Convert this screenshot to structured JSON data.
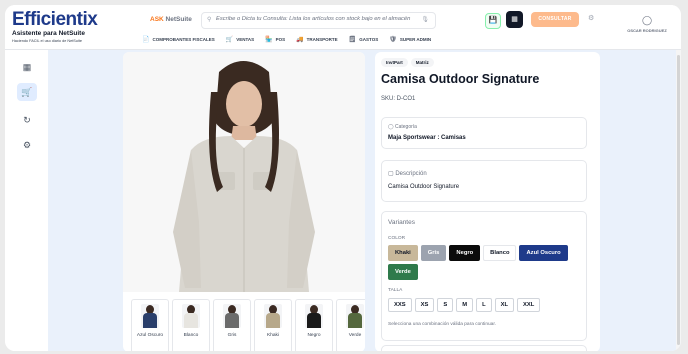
{
  "brand": {
    "logo": "Efficientix",
    "tagline": "Asistente para NetSuite",
    "subtagline": "Haciendo FACIL el uso diario de NetSuite"
  },
  "ask": {
    "label_a": "ASK",
    "label_b": "NetSuite"
  },
  "search": {
    "placeholder": "Escribe o Dicta tu Consulta: Lista los artículos con stock bajo en el almacén"
  },
  "consult_label": "CONSULTAR",
  "user": {
    "name": "OSCAR RODRIGUEZ"
  },
  "nav": [
    {
      "label": "COMPROBANTES FISCALES",
      "icon": "📄"
    },
    {
      "label": "VENTAS",
      "icon": "🛒"
    },
    {
      "label": "POS",
      "icon": "🏪"
    },
    {
      "label": "TRANSPORTE",
      "icon": "🚚"
    },
    {
      "label": "GASTOS",
      "icon": "🗒"
    },
    {
      "label": "SUPER ADMIN",
      "icon": "🛡"
    }
  ],
  "product": {
    "badges": [
      "InvtPart",
      "Matriz"
    ],
    "title": "Camisa Outdoor Signature",
    "sku": "SKU: D-CO1",
    "category_label": "Categoría",
    "category_value": "Maja Sportswear : Camisas",
    "description_label": "Descripción",
    "description_value": "Camisa Outdoor Signature",
    "variants_title": "Variantes",
    "color_label": "COLOR",
    "colors": [
      {
        "name": "Khaki",
        "bg": "#c8b89a",
        "fg": "#111827"
      },
      {
        "name": "Gris",
        "bg": "#9ca3af",
        "fg": "#ffffff"
      },
      {
        "name": "Negro",
        "bg": "#0b0b0b",
        "fg": "#ffffff"
      },
      {
        "name": "Blanco",
        "bg": "#ffffff",
        "fg": "#111827"
      },
      {
        "name": "Azul Oscuro",
        "bg": "#1e3a8a",
        "fg": "#ffffff"
      },
      {
        "name": "Verde",
        "bg": "#2f7a4b",
        "fg": "#ffffff"
      }
    ],
    "size_label": "TALLA",
    "sizes": [
      "XXS",
      "XS",
      "S",
      "M",
      "L",
      "XL",
      "XXL"
    ],
    "hint": "Selecciona una combinación válida para continuar."
  },
  "thumbnails": [
    {
      "label": "Azul Oscuro",
      "color": "#2a3f6b"
    },
    {
      "label": "Blanco",
      "color": "#e7e5e0"
    },
    {
      "label": "Gris",
      "color": "#6b6b6b"
    },
    {
      "label": "Khaki",
      "color": "#b7a88a"
    },
    {
      "label": "Negro",
      "color": "#1a1a1a"
    },
    {
      "label": "Verde",
      "color": "#55683e"
    }
  ]
}
